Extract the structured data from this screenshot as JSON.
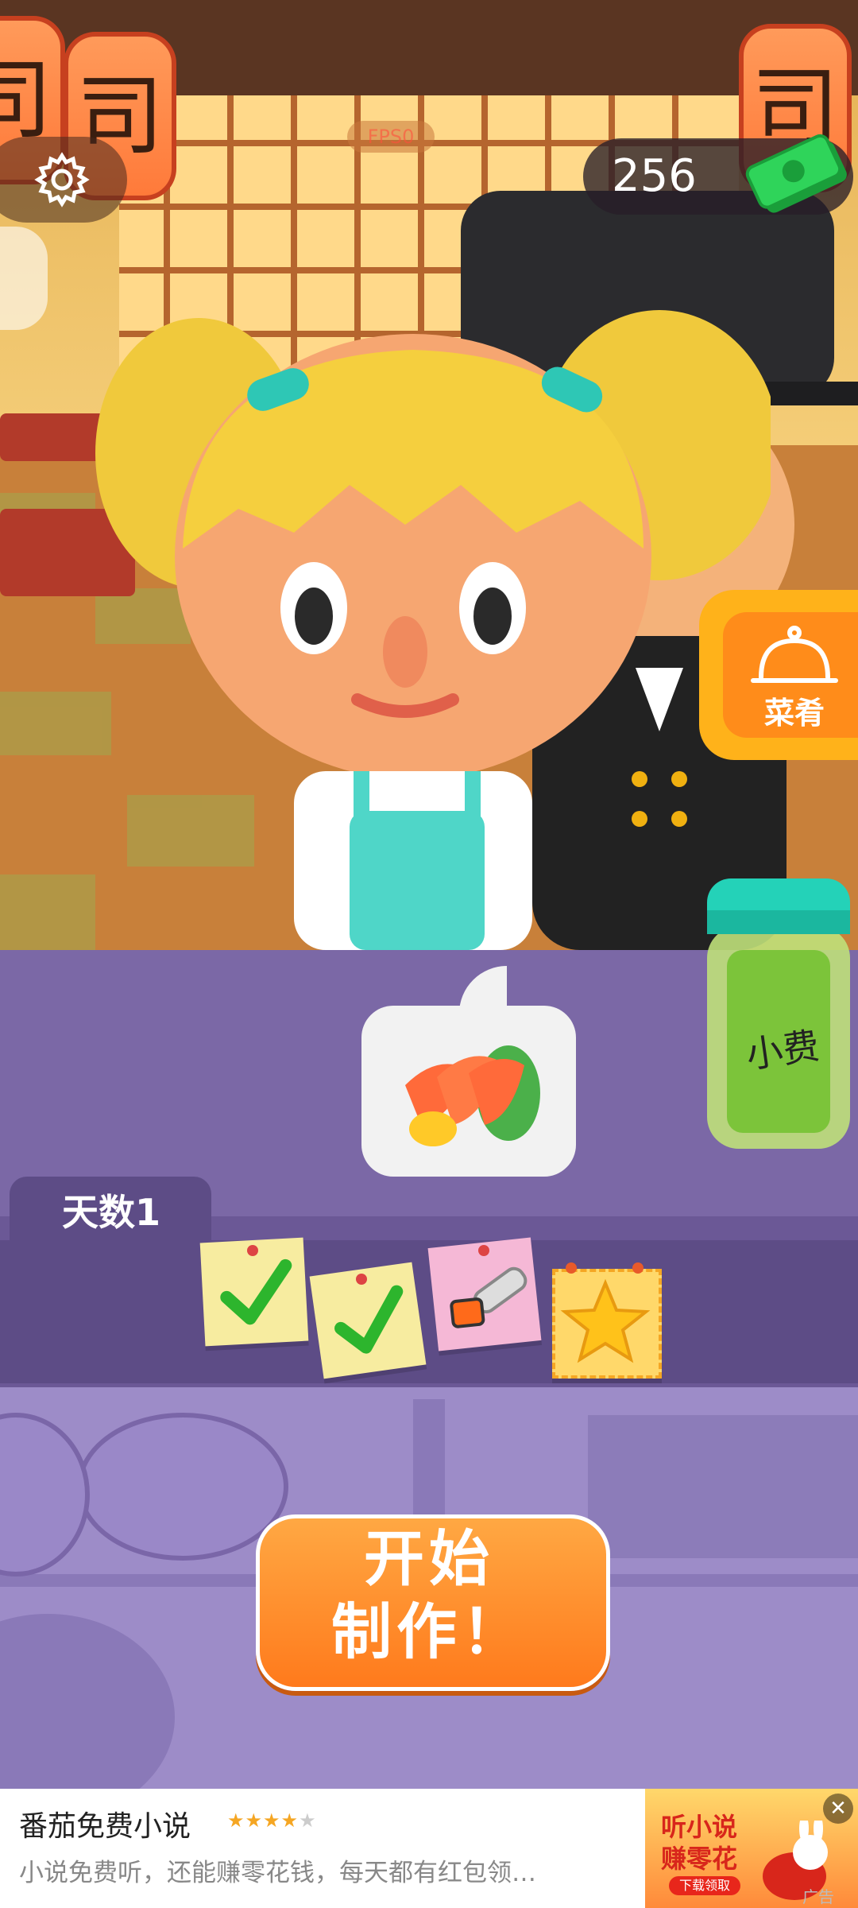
{
  "hud": {
    "fps_text": "FPS0",
    "money": "256"
  },
  "menu_button": {
    "label": "菜肴"
  },
  "order": {
    "dish_icon": "salmon-sashimi-icon"
  },
  "tip_jar": {
    "label": "小费"
  },
  "day": {
    "label": "天数1"
  },
  "progress": {
    "notes": [
      {
        "state": "completed",
        "icon": "checkmark-icon"
      },
      {
        "state": "completed",
        "icon": "checkmark-icon"
      },
      {
        "state": "current",
        "icon": "chainsaw-icon"
      },
      {
        "state": "reward",
        "icon": "star-icon"
      }
    ]
  },
  "start_button": {
    "label": "开始\n制作！"
  },
  "ad": {
    "title": "番茄免费小说",
    "rating_stars": 4,
    "stars_text": "★★★★★",
    "description": "小说免费听，还能赚零花钱，每天都有红包领…",
    "image_text": "听小说\n赚零花",
    "image_button": "下载领取",
    "tag": "广告",
    "close_icon": "close-icon"
  },
  "colors": {
    "accent_orange": "#ff8c1a",
    "counter_purple": "#7b68a6",
    "check_green": "#2db52d"
  }
}
